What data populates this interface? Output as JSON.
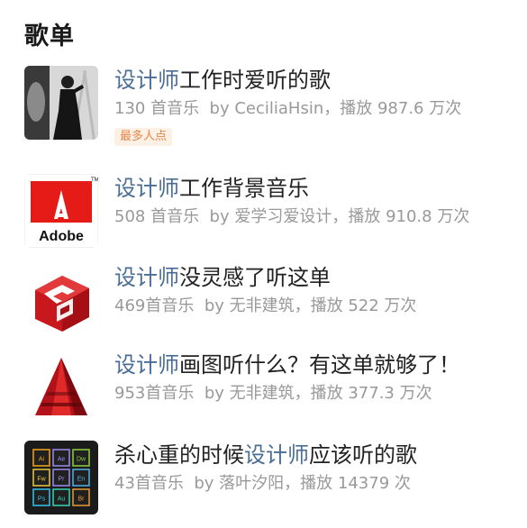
{
  "section": {
    "title": "歌单"
  },
  "playlists": [
    {
      "title_hl": "设计师",
      "title_rest": "工作时爱听的歌",
      "count": "130 首音乐",
      "author_prefix": "by",
      "author": "CeciliaHsin，",
      "plays": "播放 987.6 万次",
      "tag": "最多人点",
      "cover_icon": "photo-cover"
    },
    {
      "title_hl": "设计师",
      "title_rest": "工作背景音乐",
      "count": "508 首音乐",
      "author_prefix": "by",
      "author": "爱学习爱设计，",
      "plays": "播放 910.8 万次",
      "cover_icon": "adobe-logo",
      "cover_text": "Adobe",
      "cover_tm": "TM"
    },
    {
      "title_hl": "设计师",
      "title_rest": "没灵感了听这单",
      "count": "469首音乐",
      "author_prefix": "by",
      "author": "无非建筑，",
      "plays": "播放 522 万次",
      "cover_icon": "sketchup-logo"
    },
    {
      "title_hl": "设计师",
      "title_rest": "画图听什么？有这单就够了！",
      "count": "953首音乐",
      "author_prefix": "by",
      "author": "无非建筑，",
      "plays": "播放 377.3 万次",
      "cover_icon": "autocad-logo"
    },
    {
      "title_pre": "杀心重的时候",
      "title_hl": "设计师",
      "title_rest": "应该听的歌",
      "count": "43首音乐",
      "author_prefix": "by",
      "author": "落叶汐阳，",
      "plays": "播放 14379 次",
      "cover_icon": "adobe-suite-grid",
      "suite": [
        "Ai",
        "Ae",
        "Dw",
        "Fw",
        "Pr",
        "En",
        "Ps",
        "Au",
        "Br"
      ]
    }
  ],
  "colors": {
    "highlight": "#4a6d96",
    "meta": "#999999",
    "tag_bg": "#fdf1e6",
    "tag_text": "#e8864a"
  }
}
